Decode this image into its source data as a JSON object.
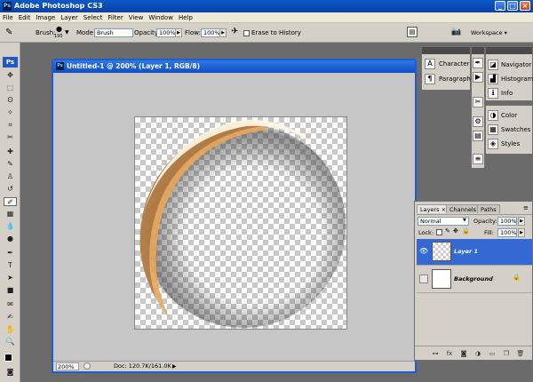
{
  "app": {
    "title": "Adobe Photoshop CS3",
    "logo": "Ps",
    "icon_text": "Ps"
  },
  "window_controls": {
    "minimize": "_",
    "maximize": "□",
    "close": "×"
  },
  "menu": [
    "File",
    "Edit",
    "Image",
    "Layer",
    "Select",
    "Filter",
    "View",
    "Window",
    "Help"
  ],
  "options": {
    "brush_label": "Brush:",
    "brush_size": "195",
    "mode_label": "Mode:",
    "mode_value": "Brush",
    "opacity_label": "Opacity:",
    "opacity_value": "100%",
    "flow_label": "Flow:",
    "flow_value": "100%",
    "erase_history_label": "Erase to History",
    "workspace_label": "Workspace ▾"
  },
  "document": {
    "title": "Untitled-1 @ 200% (Layer 1, RGB/8)",
    "zoom": "200%",
    "doc_info": "Doc: 120.7K/161.0K"
  },
  "panels": {
    "character_label": "Character",
    "paragraph_label": "Paragraph",
    "navigator_label": "Navigator",
    "histogram_label": "Histogram",
    "info_label": "Info",
    "color_label": "Color",
    "swatches_label": "Swatches",
    "styles_label": "Styles"
  },
  "layers_panel": {
    "tabs": [
      "Layers ×",
      "Channels",
      "Paths"
    ],
    "blend_mode": "Normal",
    "opacity_label": "Opacity:",
    "opacity_value": "100%",
    "lock_label": "Lock:",
    "fill_label": "Fill:",
    "fill_value": "100%",
    "layers": [
      {
        "name": "Layer 1",
        "selected": true
      },
      {
        "name": "Background",
        "selected": false
      }
    ]
  },
  "colors": {
    "titlebar": "#0a4fc4",
    "accent_selected": "#3469d4",
    "workspace": "#6b6b6b"
  }
}
